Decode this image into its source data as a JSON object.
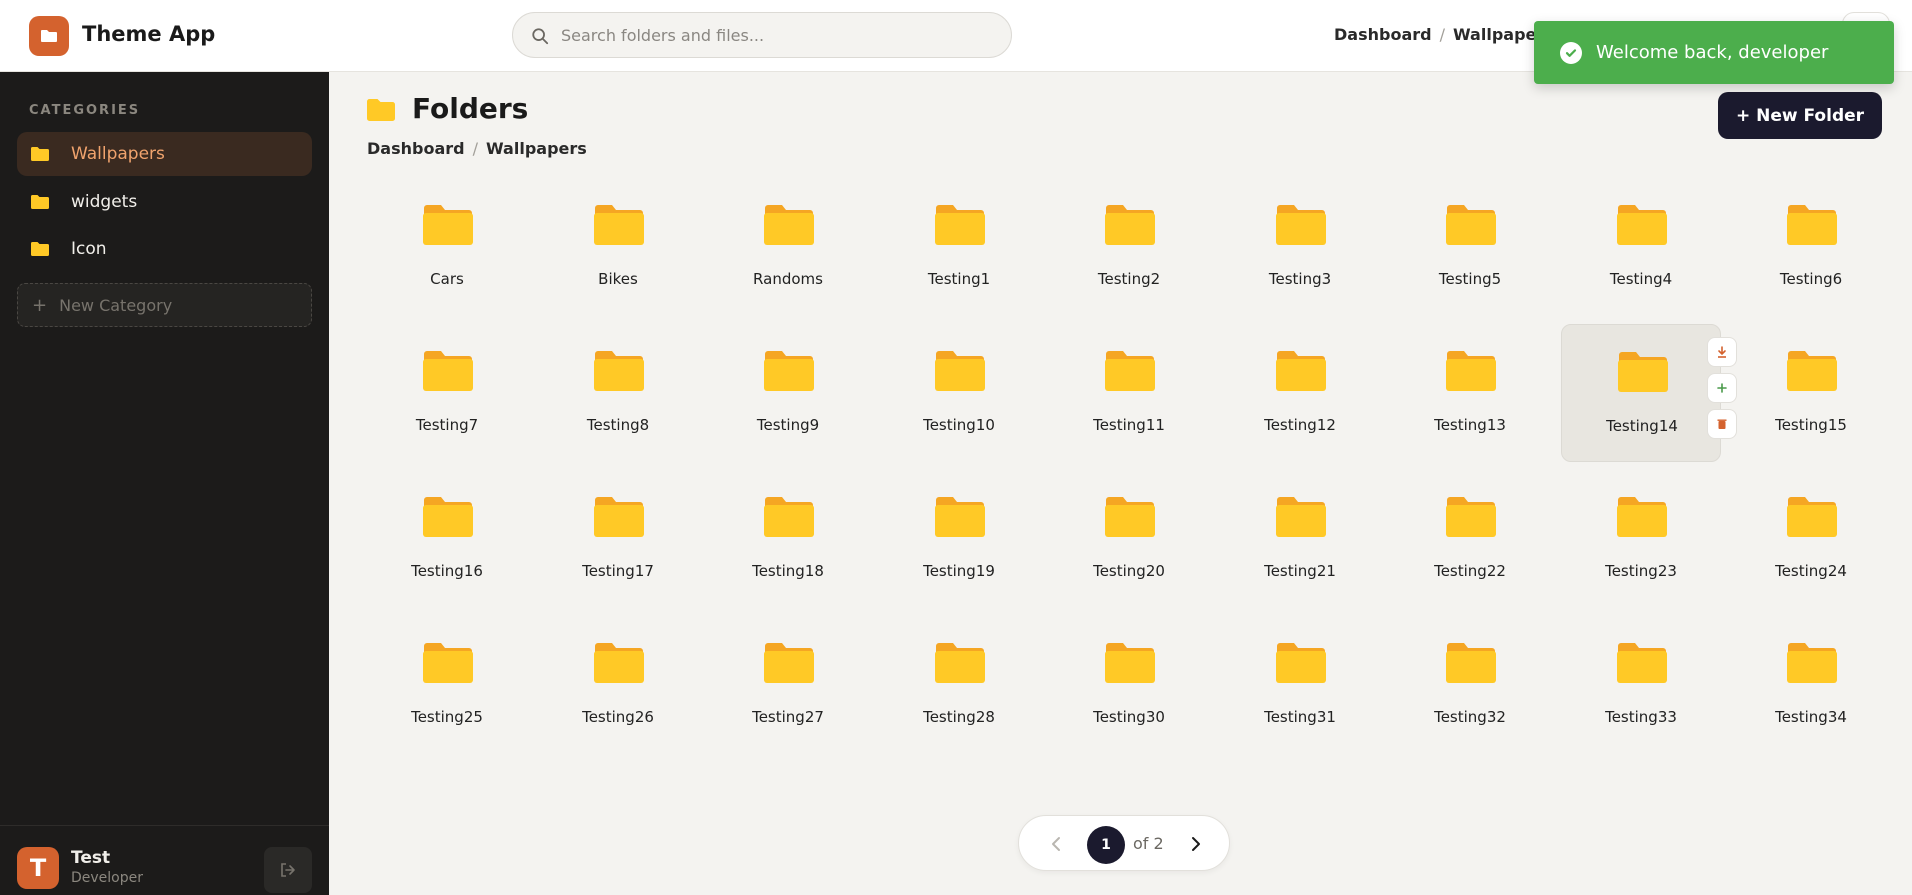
{
  "app": {
    "title": "Theme App"
  },
  "search": {
    "placeholder": "Search folders and files..."
  },
  "header_breadcrumb": [
    "Dashboard",
    "Wallpapers"
  ],
  "toast": {
    "message": "Welcome back, developer",
    "color": "#4cae4c"
  },
  "sidebar": {
    "heading": "CATEGORIES",
    "items": [
      {
        "label": "Wallpapers",
        "active": true
      },
      {
        "label": "widgets",
        "active": false
      },
      {
        "label": "Icon",
        "active": false
      }
    ],
    "new_category_label": "New Category",
    "user": {
      "initial": "T",
      "name": "Test",
      "role": "Developer"
    }
  },
  "main": {
    "title": "Folders",
    "breadcrumb": [
      "Dashboard",
      "Wallpapers"
    ],
    "new_folder_label": "+ New Folder",
    "folders": [
      "Cars",
      "Bikes",
      "Randoms",
      "Testing1",
      "Testing2",
      "Testing3",
      "Testing5",
      "Testing4",
      "Testing6",
      "Testing7",
      "Testing8",
      "Testing9",
      "Testing10",
      "Testing11",
      "Testing12",
      "Testing13",
      "Testing14",
      "Testing15",
      "Testing16",
      "Testing17",
      "Testing18",
      "Testing19",
      "Testing20",
      "Testing21",
      "Testing22",
      "Testing23",
      "Testing24",
      "Testing25",
      "Testing26",
      "Testing27",
      "Testing28",
      "Testing30",
      "Testing31",
      "Testing32",
      "Testing33",
      "Testing34"
    ],
    "hovered_folder": "Testing14",
    "hover_actions": [
      "download-icon",
      "plus-icon",
      "trash-icon"
    ]
  },
  "pagination": {
    "current": "1",
    "of_label": "of 2"
  },
  "colors": {
    "accent": "#d4622e",
    "folder": "#ffc926",
    "folder_tab": "#f5a623",
    "dark_button": "#1b1a2e",
    "sidebar_bg": "#1c1b1a"
  }
}
